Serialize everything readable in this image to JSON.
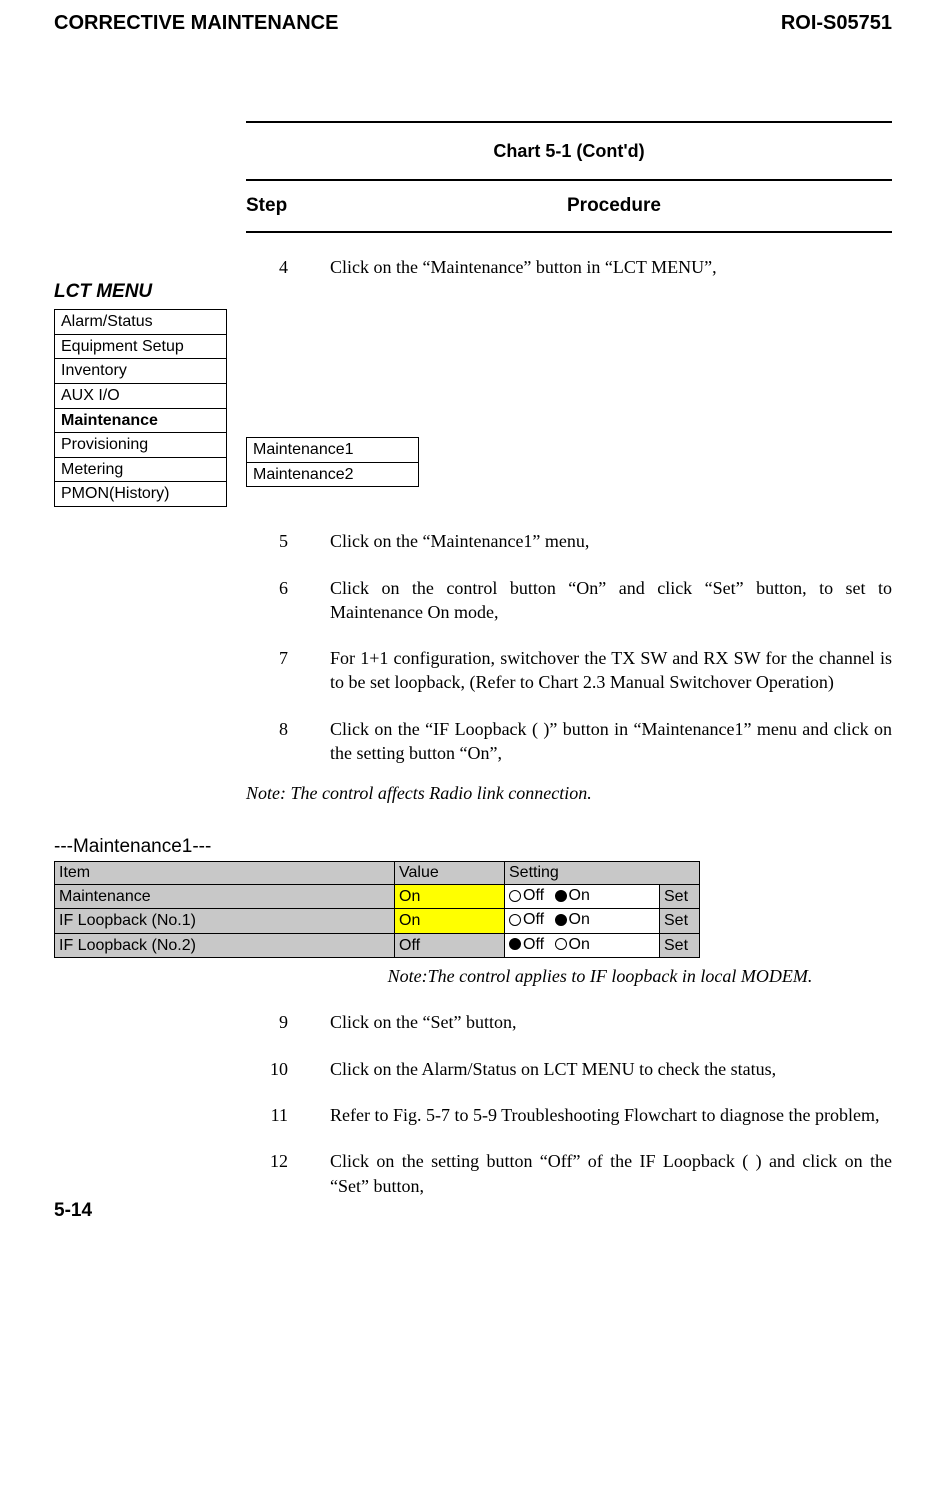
{
  "header": {
    "left": "CORRECTIVE MAINTENANCE",
    "right": "ROI-S05751"
  },
  "chart": {
    "title": "Chart 5-1  (Cont'd)",
    "step_label": "Step",
    "proc_label": "Procedure"
  },
  "steps": {
    "s4": {
      "n": "4",
      "t": "Click on the “Maintenance” button in “LCT MENU”,"
    },
    "s5": {
      "n": "5",
      "t": "Click on the “Maintenance1” menu,"
    },
    "s6": {
      "n": "6",
      "t": "Click on the control button “On” and click “Set” button, to set to Maintenance On mode,"
    },
    "s7": {
      "n": "7",
      "t": "For 1+1 configuration, switchover the TX SW and RX SW for the channel is to be set loopback, (Refer to Chart 2.3 Manual Switchover Operation)"
    },
    "s8": {
      "n": "8",
      "t": "Click on the “IF Loopback ( )” button in “Maintenance1” menu and click on the setting button “On”,"
    },
    "s9": {
      "n": "9",
      "t": "Click on the “Set” button,"
    },
    "s10": {
      "n": "10",
      "t": "Click on the Alarm/Status on LCT MENU to check the status,"
    },
    "s11": {
      "n": "11",
      "t": "Refer to Fig. 5-7 to 5-9 Troubleshooting Flowchart to diagnose the problem,"
    },
    "s12": {
      "n": "12",
      "t": "Click on the setting button “Off” of the IF Loopback ( ) and click on the “Set” button,"
    }
  },
  "notes": {
    "n1": "Note: The control affects Radio link connection.",
    "n2": "Note:The control applies to IF loopback in local MODEM."
  },
  "lct": {
    "title": "LCT MENU",
    "items": [
      "Alarm/Status",
      "Equipment Setup",
      "Inventory",
      "AUX I/O",
      "Maintenance",
      "Provisioning",
      "Metering",
      "PMON(History)"
    ],
    "sub": [
      "Maintenance1",
      "Maintenance2"
    ]
  },
  "m1": {
    "title": "---Maintenance1---",
    "headers": {
      "item": "Item",
      "value": "Value",
      "setting": "Setting"
    },
    "off": "Off",
    "on": "On",
    "set": "Set",
    "rows": {
      "r0": {
        "item": "Maintenance",
        "val": "On",
        "sel": "on"
      },
      "r1": {
        "item": "IF Loopback (No.1)",
        "val": "On",
        "sel": "on"
      },
      "r2": {
        "item": "IF Loopback (No.2)",
        "val": "Off",
        "sel": "off"
      }
    }
  },
  "footer": "5-14"
}
